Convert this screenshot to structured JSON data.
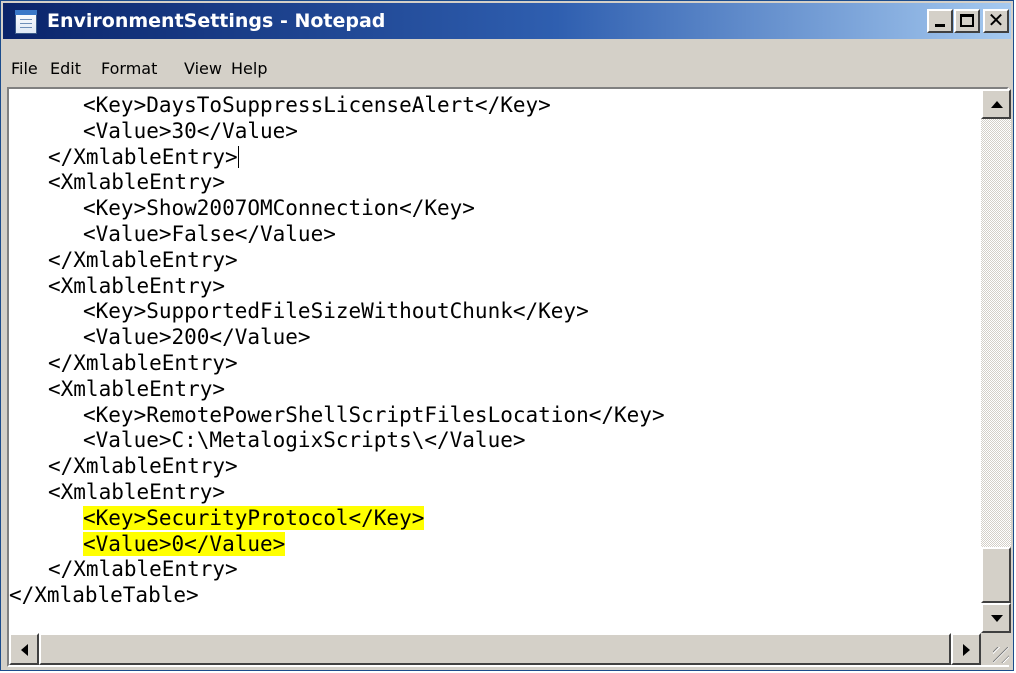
{
  "window": {
    "title": "EnvironmentSettings - Notepad",
    "app_icon": "notepad-icon"
  },
  "title_buttons": {
    "minimize_icon": "minimize-icon",
    "maximize_icon": "maximize-icon",
    "close_icon": "close-icon",
    "close_glyph": "✕"
  },
  "menu": {
    "items": [
      "File",
      "Edit",
      "Format",
      "View",
      "Help"
    ]
  },
  "editor": {
    "lines": [
      "<Key>DaysToSuppressLicenseAlert</Key>",
      "<Value>30</Value>",
      "</XmlableEntry>",
      "<XmlableEntry>",
      "<Key>Show2007OMConnection</Key>",
      "<Value>False</Value>",
      "</XmlableEntry>",
      "<XmlableEntry>",
      "<Key>SupportedFileSizeWithoutChunk</Key>",
      "<Value>200</Value>",
      "</XmlableEntry>",
      "<XmlableEntry>",
      "<Key>RemotePowerShellScriptFilesLocation</Key>",
      "<Value>C:\\MetalogixScripts\\</Value>",
      "</XmlableEntry>",
      "<XmlableEntry>",
      "<Key>SecurityProtocol</Key>",
      "<Value>0</Value>",
      "</XmlableEntry>",
      "</XmlableTable>"
    ],
    "highlight_color": "#ffff00"
  },
  "colors": {
    "titlebar_start": "#0a246a",
    "titlebar_end": "#a6caf0",
    "chrome": "#d4d0c8"
  }
}
